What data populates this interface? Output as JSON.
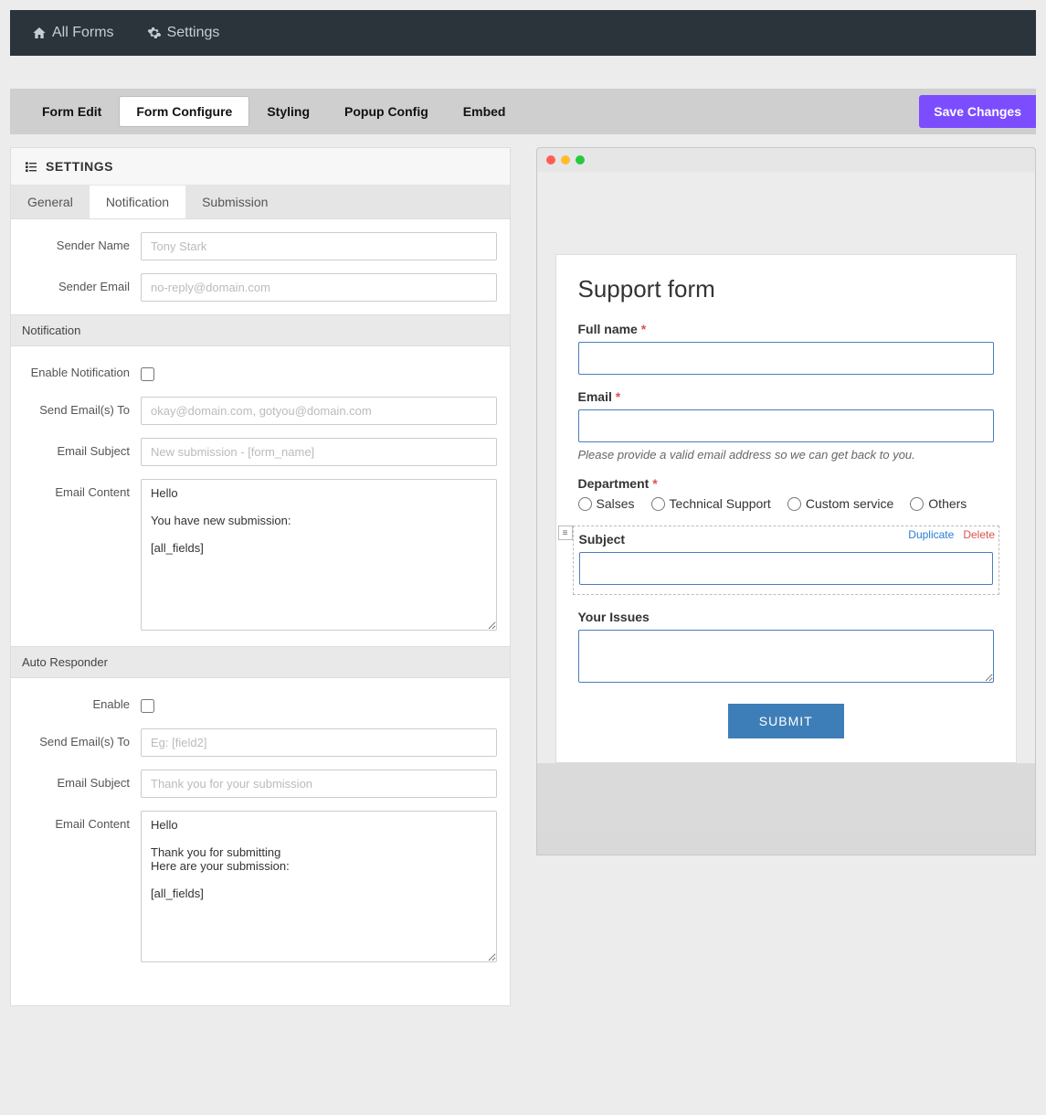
{
  "topnav": {
    "all_forms": "All Forms",
    "settings": "Settings"
  },
  "tabs": {
    "form_edit": "Form Edit",
    "form_configure": "Form Configure",
    "styling": "Styling",
    "popup_config": "Popup Config",
    "embed": "Embed"
  },
  "save_btn": "Save Changes",
  "settings_panel": {
    "title": "SETTINGS",
    "tabs": {
      "general": "General",
      "notification": "Notification",
      "submission": "Submission"
    },
    "sender_name_label": "Sender Name",
    "sender_name_ph": "Tony Stark",
    "sender_email_label": "Sender Email",
    "sender_email_ph": "no-reply@domain.com",
    "notification_header": "Notification",
    "enable_notification_label": "Enable Notification",
    "send_emails_to_label": "Send Email(s) To",
    "send_emails_to_ph": "okay@domain.com, gotyou@domain.com",
    "email_subject_label": "Email Subject",
    "email_subject_ph": "New submission - [form_name]",
    "email_content_label": "Email Content",
    "email_content_val": "Hello\n\nYou have new submission:\n\n[all_fields]",
    "autoresponder_header": "Auto Responder",
    "ar_enable_label": "Enable",
    "ar_send_to_label": "Send Email(s) To",
    "ar_send_to_ph": "Eg: [field2]",
    "ar_subject_label": "Email Subject",
    "ar_subject_ph": "Thank you for your submission",
    "ar_content_label": "Email Content",
    "ar_content_val": "Hello\n\nThank you for submitting\nHere are your submission:\n\n[all_fields]"
  },
  "preview": {
    "title": "Support form",
    "full_name_label": "Full name",
    "email_label": "Email",
    "email_help": "Please provide a valid email address so we can get back to you.",
    "department_label": "Department",
    "radios": [
      "Salses",
      "Technical Support",
      "Custom service",
      "Others"
    ],
    "subject_label": "Subject",
    "duplicate": "Duplicate",
    "delete": "Delete",
    "issues_label": "Your Issues",
    "submit": "SUBMIT"
  }
}
